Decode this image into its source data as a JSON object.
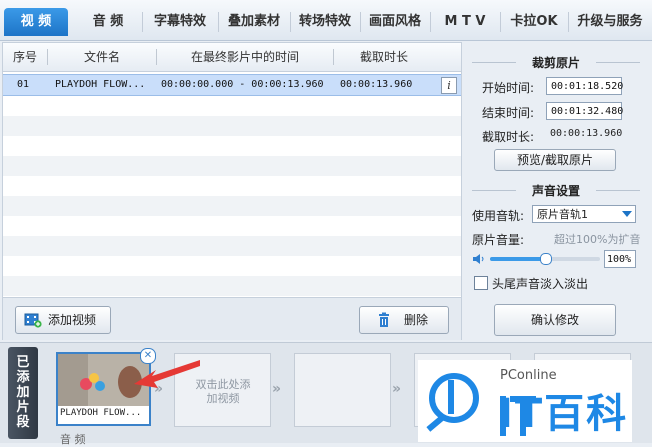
{
  "tabs": [
    {
      "label": "视 频",
      "active": true
    },
    {
      "label": "音 频"
    },
    {
      "label": "字幕特效"
    },
    {
      "label": "叠加素材"
    },
    {
      "label": "转场特效"
    },
    {
      "label": "画面风格"
    },
    {
      "label": "M T V"
    },
    {
      "label": "卡拉OK"
    },
    {
      "label": "升级与服务"
    }
  ],
  "table": {
    "headers": [
      "序号",
      "文件名",
      "在最终影片中的时间",
      "截取时长"
    ],
    "rows": [
      {
        "index": "01",
        "filename": "PLAYDOH FLOW...",
        "time": "00:00:00.000 - 00:00:13.960",
        "duration": "00:00:13.960",
        "info": "i"
      }
    ]
  },
  "actions": {
    "add_video": "添加视频",
    "delete": "删除"
  },
  "trim": {
    "title": "裁剪原片",
    "start_label": "开始时间:",
    "start_value": "00:01:18.520",
    "end_label": "结束时间:",
    "end_value": "00:01:32.480",
    "duration_label": "截取时长:",
    "duration_value": "00:00:13.960",
    "preview_button": "预览/截取原片"
  },
  "audio": {
    "title": "声音设置",
    "track_label": "使用音轨:",
    "track_value": "原片音轨1",
    "volume_label": "原片音量:",
    "volume_hint": "超过100%为扩音",
    "volume_value": "100%",
    "volume_level": 0.5,
    "fade_label": "头尾声音淡入淡出",
    "fade_checked": false,
    "confirm_button": "确认修改"
  },
  "timeline": {
    "tab_label": "已添加片段",
    "clip_name": "PLAYDOH FLOW...",
    "empty_slot_text": "双击此处添加视频",
    "audio_label": "音 频"
  },
  "watermark": {
    "brand": "PConline",
    "name": "IT百科"
  },
  "colors": {
    "accent": "#1d74c7",
    "selection": "#c9defa",
    "red_arrow": "#e53935"
  }
}
